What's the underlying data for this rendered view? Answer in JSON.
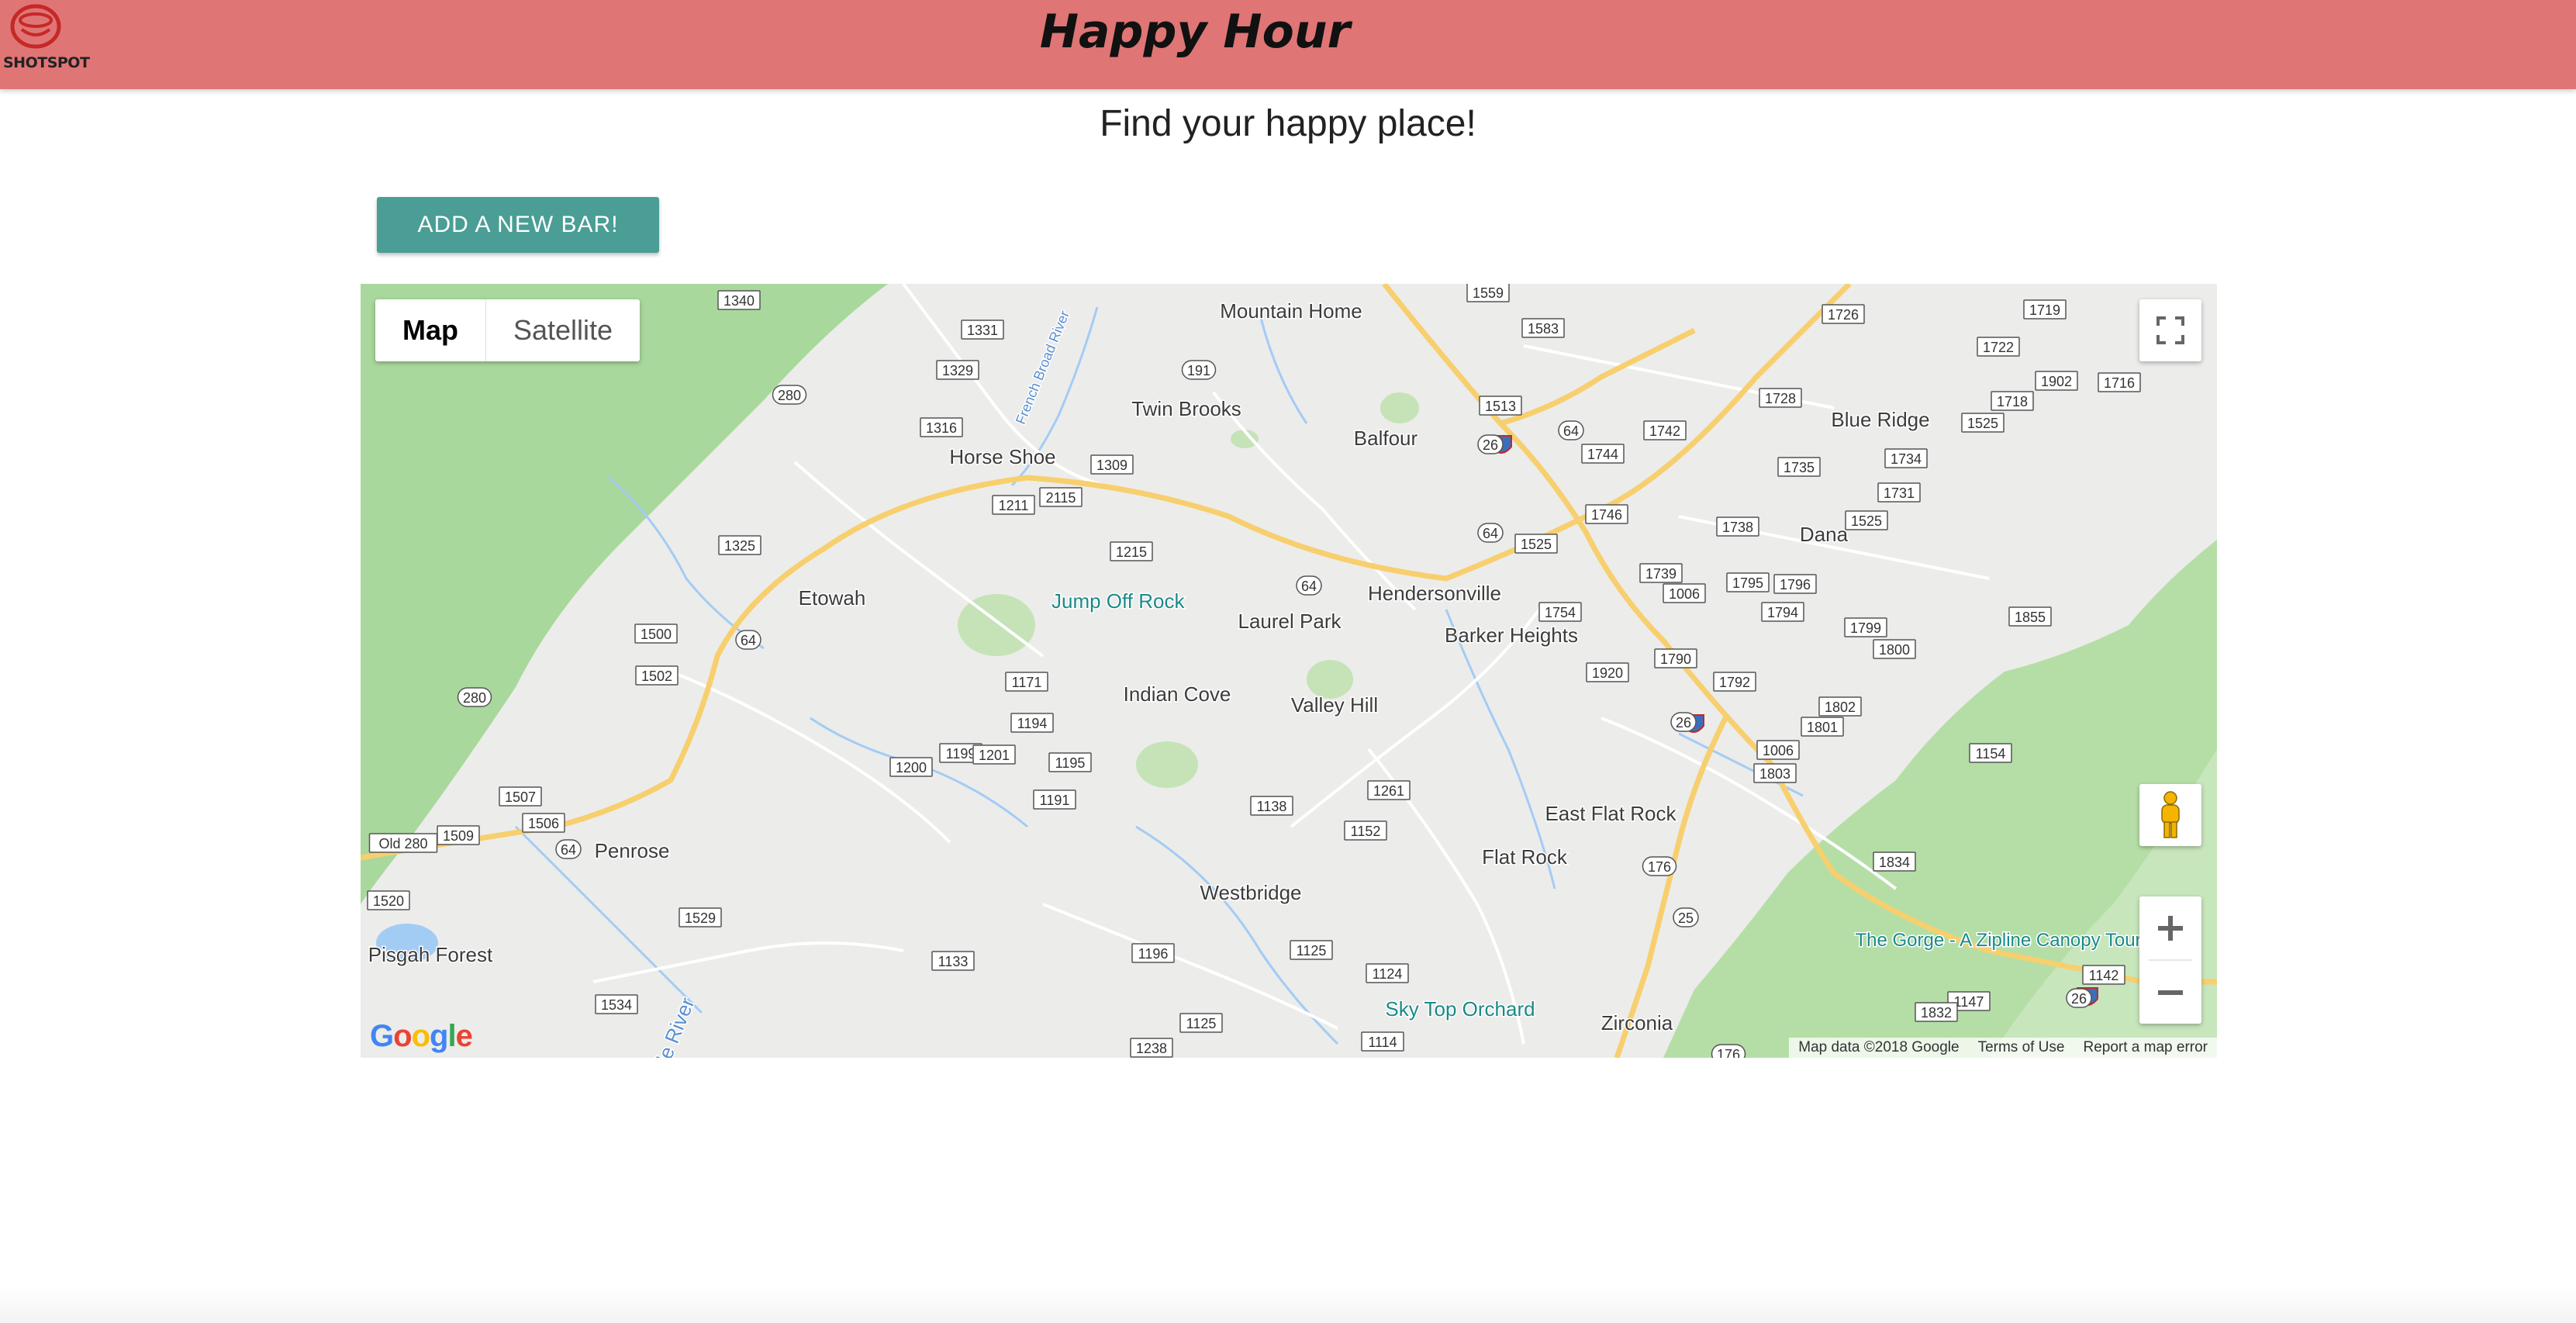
{
  "header": {
    "logo_text": "SHOTSPOT",
    "title": "Happy Hour"
  },
  "main": {
    "tagline": "Find your happy place!",
    "add_button_label": "ADD A NEW BAR!"
  },
  "map": {
    "map_type_options": [
      "Map",
      "Satellite"
    ],
    "selected_map_type": "Map",
    "places": [
      {
        "name": "Mountain Home"
      },
      {
        "name": "Twin Brooks"
      },
      {
        "name": "Balfour"
      },
      {
        "name": "Blue Ridge"
      },
      {
        "name": "Horse Shoe"
      },
      {
        "name": "Dana"
      },
      {
        "name": "Etowah"
      },
      {
        "name": "Jump Off Rock"
      },
      {
        "name": "Laurel Park"
      },
      {
        "name": "Hendersonville"
      },
      {
        "name": "Barker Heights"
      },
      {
        "name": "Indian Cove"
      },
      {
        "name": "Valley Hill"
      },
      {
        "name": "East Flat Rock"
      },
      {
        "name": "Flat Rock"
      },
      {
        "name": "Penrose"
      },
      {
        "name": "Westbridge"
      },
      {
        "name": "Pisgah Forest"
      },
      {
        "name": "The Gorge - A Zipline Canopy Tour"
      },
      {
        "name": "Sky Top Orchard"
      },
      {
        "name": "Zirconia"
      },
      {
        "name": "Little River"
      },
      {
        "name": "French Broad River"
      }
    ],
    "road_labels": [
      "1340",
      "1559",
      "1583",
      "1726",
      "1719",
      "1331",
      "1329",
      "191",
      "1722",
      "1902",
      "1718",
      "1716",
      "280",
      "1316",
      "1513",
      "26",
      "64",
      "1744",
      "1742",
      "1728",
      "1525",
      "1734",
      "1735",
      "1731",
      "1309",
      "2115",
      "1211",
      "1325",
      "64",
      "1525",
      "1746",
      "1738",
      "1525",
      "1215",
      "64",
      "1739",
      "1006",
      "1795",
      "1796",
      "1754",
      "1794",
      "1855",
      "1799",
      "1800",
      "1500",
      "64",
      "1502",
      "1171",
      "1920",
      "1790",
      "1792",
      "280",
      "1194",
      "1802",
      "26",
      "1801",
      "1006",
      "1195",
      "1154",
      "1200",
      "1199",
      "1201",
      "1803",
      "1191",
      "1261",
      "1507",
      "1138",
      "1152",
      "1506",
      "1509",
      "Old 280",
      "64",
      "176",
      "1834",
      "1520",
      "1529",
      "25",
      "1133",
      "1196",
      "1125",
      "1124",
      "1142",
      "1147",
      "1534",
      "1832",
      "1125",
      "1238",
      "1114",
      "176",
      "26"
    ],
    "google_logo_text": "Google",
    "attribution": {
      "map_data": "Map data ©2018 Google",
      "terms": "Terms of Use",
      "report": "Report a map error"
    },
    "controls": {
      "zoom_in": "+",
      "zoom_out": "−"
    },
    "colors": {
      "land": "#ececea",
      "forest": "#a8d89a",
      "major_road": "#f7cf6e",
      "water": "#a3ccf5",
      "interstate": "#3b6fbd"
    }
  },
  "colors": {
    "header": "#e07575",
    "button": "#4a9e95"
  }
}
